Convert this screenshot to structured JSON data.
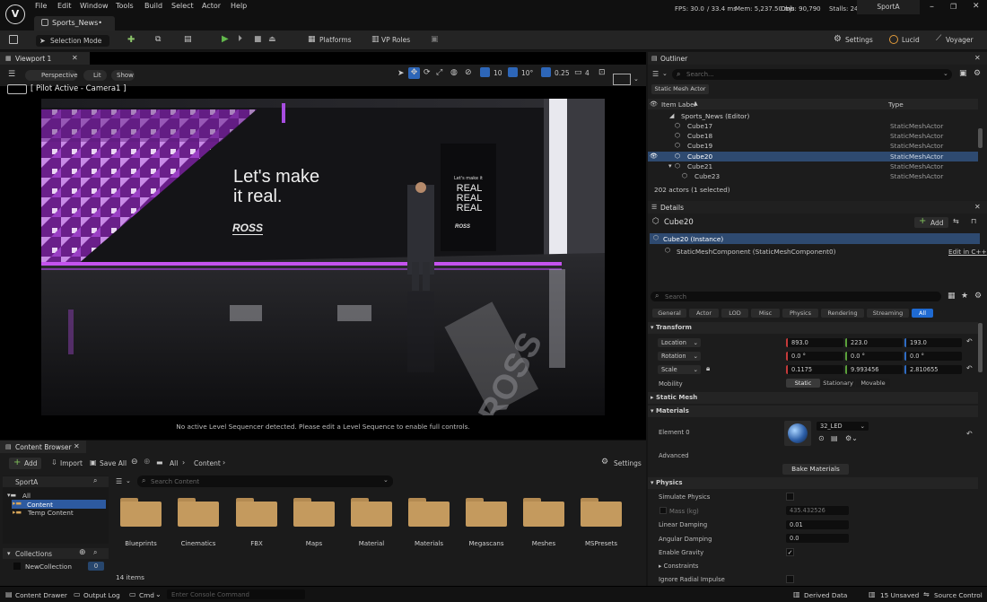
{
  "menu": [
    "File",
    "Edit",
    "Window",
    "Tools",
    "Build",
    "Select",
    "Actor",
    "Help"
  ],
  "title_tab": "Sports_News•",
  "stats": {
    "fps": "FPS: 30.0",
    "ms": "/ 33.4 ms",
    "mem": "Mem: 5,237.50 mb",
    "objs": "Objs: 90,790",
    "stalls": "Stalls: 24"
  },
  "project_name": "SportA",
  "toolbar": {
    "mode": "Selection Mode",
    "platforms": "Platforms",
    "vp_roles": "VP Roles",
    "settings": "Settings",
    "lucid": "Lucid",
    "voyager": "Voyager"
  },
  "viewport": {
    "tab": "Viewport 1",
    "perspective": "Perspective",
    "lit": "Lit",
    "show": "Show",
    "pilot": "[ Pilot Active - Camera1 ]",
    "grid": "10",
    "angle": "10°",
    "scale": "0.25",
    "cam": "4",
    "sequencer_msg": "No active Level Sequencer detected. Please edit a Level Sequence to enable full controls.",
    "slogan_line1": "Let's make",
    "slogan_line2": "it real.",
    "ross": "ROSS",
    "panel_small": "Let's make it",
    "panel_real": "REAL"
  },
  "content_browser": {
    "tab": "Content Browser",
    "add": "Add",
    "import": "Import",
    "save_all": "Save All",
    "crumb_all": "All",
    "crumb_content": "Content",
    "settings": "Settings",
    "search_placeholder": "Search Content",
    "tree_root": "SportA",
    "tree_all": "All",
    "tree_content": "Content",
    "tree_temp": "Temp Content",
    "collections": "Collections",
    "new_collection": "NewCollection",
    "collection_count": "0",
    "folders": [
      "Blueprints",
      "Cinematics",
      "FBX",
      "Maps",
      "Material",
      "Materials",
      "Megascans",
      "Meshes",
      "MSPresets"
    ],
    "items": "14 items"
  },
  "outliner": {
    "tab": "Outliner",
    "search_placeholder": "Search...",
    "filter_chip": "Static Mesh Actor",
    "col_label": "Item Label",
    "col_type": "Type",
    "rows": [
      {
        "label": "Sports_News (Editor)",
        "type": ""
      },
      {
        "label": "Cube17",
        "type": "StaticMeshActor"
      },
      {
        "label": "Cube18",
        "type": "StaticMeshActor"
      },
      {
        "label": "Cube19",
        "type": "StaticMeshActor"
      },
      {
        "label": "Cube20",
        "type": "StaticMeshActor"
      },
      {
        "label": "Cube21",
        "type": "StaticMeshActor"
      },
      {
        "label": "Cube23",
        "type": "StaticMeshActor"
      }
    ],
    "count": "202 actors (1 selected)"
  },
  "details": {
    "tab": "Details",
    "object": "Cube20",
    "add": "Add",
    "instance": "Cube20 (Instance)",
    "component": "StaticMeshComponent (StaticMeshComponent0)",
    "edit_cpp": "Edit in C++",
    "search_placeholder": "Search",
    "filters": [
      "General",
      "Actor",
      "LOD",
      "Misc",
      "Physics",
      "Rendering",
      "Streaming",
      "All"
    ],
    "transform": "Transform",
    "location": "Location",
    "loc": [
      "893.0",
      "223.0",
      "193.0"
    ],
    "rotation": "Rotation",
    "rot": [
      "0.0 °",
      "0.0 °",
      "0.0 °"
    ],
    "scale": "Scale",
    "scl": [
      "0.1175",
      "9.993456",
      "2.810655"
    ],
    "mobility": "Mobility",
    "mob": [
      "Static",
      "Stationary",
      "Movable"
    ],
    "static_mesh": "Static Mesh",
    "materials": "Materials",
    "element0": "Element 0",
    "material_name": "32_LED",
    "advanced": "Advanced",
    "bake": "Bake Materials",
    "physics": "Physics",
    "simulate": "Simulate Physics",
    "mass": "Mass (kg)",
    "mass_val": "435.432526",
    "lin_damp": "Linear Damping",
    "lin_damp_val": "0.01",
    "ang_damp": "Angular Damping",
    "ang_damp_val": "0.0",
    "gravity": "Enable Gravity",
    "constraints": "Constraints",
    "ignore_radial": "Ignore Radial Impulse"
  },
  "status": {
    "drawer": "Content Drawer",
    "output": "Output Log",
    "cmd": "Cmd",
    "console_placeholder": "Enter Console Command",
    "derived": "Derived Data",
    "unsaved": "15 Unsaved",
    "source": "Source Control"
  }
}
